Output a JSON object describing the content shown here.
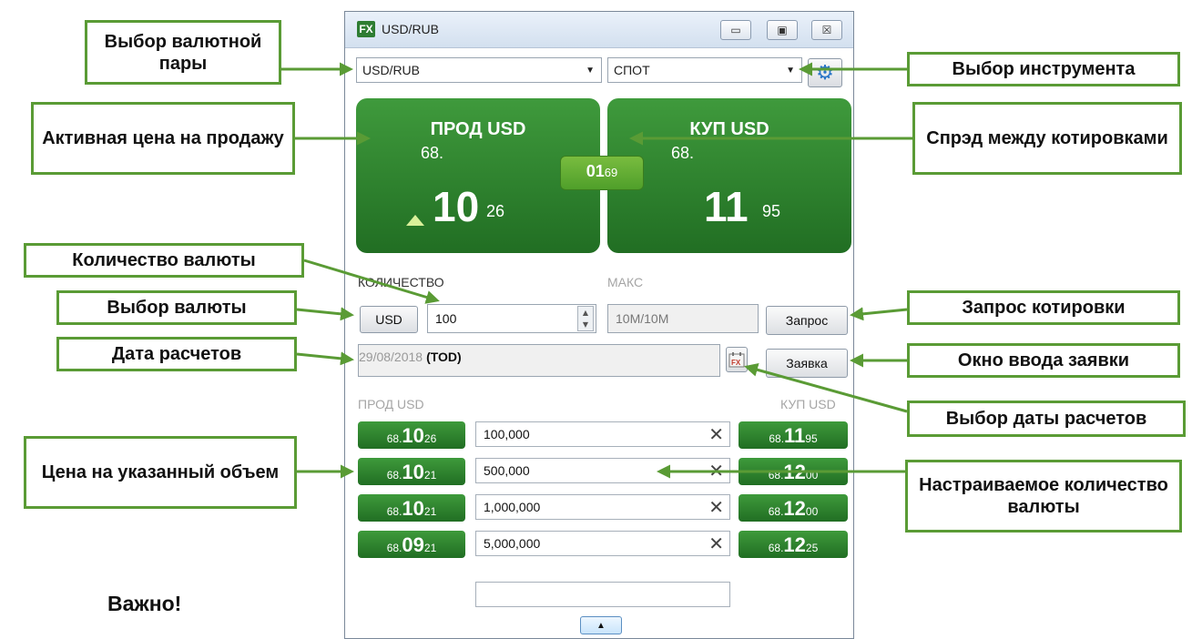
{
  "annotations": {
    "pair_select": "Выбор валютной пары",
    "instrument_select": "Выбор инструмента",
    "active_sell": "Активная цена на продажу",
    "spread": "Спрэд между котировками",
    "quantity": "Количество валюты",
    "currency_select": "Выбор валюты",
    "settle_date": "Дата расчетов",
    "quote_request": "Запрос котировки",
    "order_window": "Окно ввода заявки",
    "settle_date_select": "Выбор даты расчетов",
    "price_for_volume": "Цена на указанный объем",
    "custom_quantity": "Настраиваемое количество валюты",
    "important": "Важно!"
  },
  "window": {
    "logo": "FX",
    "title": "USD/RUB",
    "minimize": "▭",
    "maximize": "▣",
    "close": "☒"
  },
  "pair_combo": "USD/RUB",
  "instrument_combo": "СПОТ",
  "sell": {
    "header": "ПРОД USD",
    "prefix": "68.",
    "big": "10",
    "tail": "26"
  },
  "buy": {
    "header": "КУП USD",
    "prefix": "68.",
    "big": "11",
    "tail": "95"
  },
  "spread": {
    "big": "01",
    "tail": "69"
  },
  "quantity_label": "КОЛИЧЕСТВО",
  "max_label": "МАКС",
  "currency_button": "USD",
  "quantity_value": "100",
  "max_value": "10M/10M",
  "request_button": "Запрос",
  "date_value": "29/08/2018",
  "date_tag": "(TOD)",
  "order_button": "Заявка",
  "ladder_sell_label": "ПРОД USD",
  "ladder_buy_label": "КУП USD",
  "ladder": [
    {
      "sell_pre": "68.",
      "sell_big": "10",
      "sell_tail": "26",
      "qty": "100,000",
      "buy_pre": "68.",
      "buy_big": "11",
      "buy_tail": "95"
    },
    {
      "sell_pre": "68.",
      "sell_big": "10",
      "sell_tail": "21",
      "qty": "500,000",
      "buy_pre": "68.",
      "buy_big": "12",
      "buy_tail": "00"
    },
    {
      "sell_pre": "68.",
      "sell_big": "10",
      "sell_tail": "21",
      "qty": "1,000,000",
      "buy_pre": "68.",
      "buy_big": "12",
      "buy_tail": "00"
    },
    {
      "sell_pre": "68.",
      "sell_big": "09",
      "sell_tail": "21",
      "qty": "5,000,000",
      "buy_pre": "68.",
      "buy_big": "12",
      "buy_tail": "25"
    }
  ],
  "extra_qty": ""
}
